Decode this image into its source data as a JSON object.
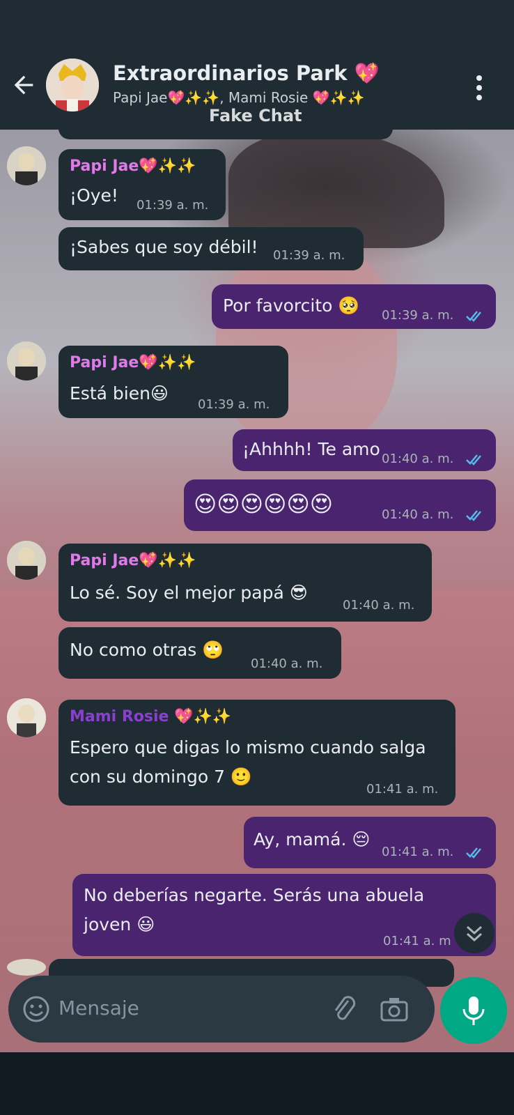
{
  "header": {
    "back_icon": "arrow-left-icon",
    "title": "Extraordinarios Park 💖",
    "participants": "Papi Jae💖✨✨, Mami Rosie 💖✨✨",
    "watermark": "Fake Chat",
    "menu_icon": "kebab-menu-icon"
  },
  "messages": [
    {
      "sender": "Papi Jae💖✨✨",
      "text": "¡Oye!",
      "time": "01:39 a. m."
    },
    {
      "text": "¡Sabes que soy débil!",
      "time": "01:39 a. m."
    },
    {
      "text": "Por favorcito 🥺",
      "time": "01:39 a. m."
    },
    {
      "sender": "Papi Jae💖✨✨",
      "text": "Está bien😃",
      "time": "01:39 a. m."
    },
    {
      "text": "¡Ahhhh! Te amo",
      "time": "01:40 a. m."
    },
    {
      "text": "😍😍😍😍😍😍",
      "time": "01:40 a. m."
    },
    {
      "sender": "Papi Jae💖✨✨",
      "text": "Lo sé. Soy el mejor papá 😎",
      "time": "01:40 a. m."
    },
    {
      "text": "No como otras 🙄",
      "time": "01:40 a. m."
    },
    {
      "sender": "Mami Rosie 💖✨✨",
      "text_line1": "Espero que digas lo mismo cuando salga",
      "text_line2": "con su domingo 7 🙂",
      "time": "01:41 a. m."
    },
    {
      "text": "Ay, mamá. 😔",
      "time": "01:41 a. m."
    },
    {
      "text_line1": "No deberías negarte. Serás una abuela",
      "text_line2": "joven 😃",
      "time": "01:41 a. m"
    }
  ],
  "input": {
    "placeholder": "Mensaje"
  },
  "colors": {
    "incoming_bubble": "#1f2c34",
    "outgoing_bubble": "#4b2470",
    "jae_name": "#e07ae8",
    "rosie_name": "#8b3fd0",
    "mic_button": "#00a884",
    "read_ticks": "#53bdeb"
  }
}
